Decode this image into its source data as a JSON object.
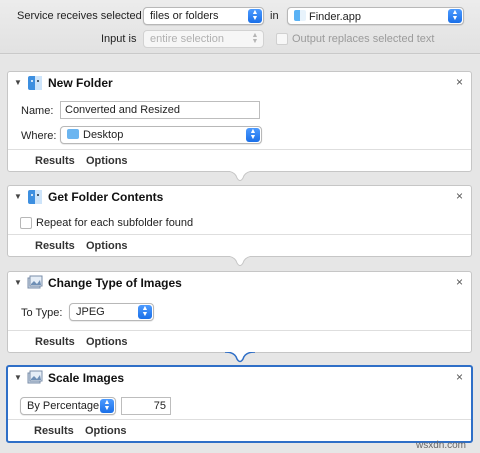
{
  "service": {
    "receives_label": "Service receives selected",
    "receives_value": "files or folders",
    "in_label": "in",
    "app_value": "Finder.app",
    "input_label": "Input is",
    "input_value": "entire selection",
    "replace_label": "Output replaces selected text"
  },
  "actions": [
    {
      "title": "New Folder",
      "name_label": "Name:",
      "name_value": "Converted and Resized",
      "where_label": "Where:",
      "where_value": "Desktop",
      "results": "Results",
      "options": "Options"
    },
    {
      "title": "Get Folder Contents",
      "repeat_label": "Repeat for each subfolder found",
      "results": "Results",
      "options": "Options"
    },
    {
      "title": "Change Type of Images",
      "type_label": "To Type:",
      "type_value": "JPEG",
      "results": "Results",
      "options": "Options"
    },
    {
      "title": "Scale Images",
      "scale_mode": "By Percentage",
      "scale_value": "75",
      "results": "Results",
      "options": "Options"
    }
  ],
  "close_glyph": "×",
  "watermark": "wsxdn.com",
  "colors": {
    "selection": "#2f6fc7",
    "popup_arrows": "#1a6fe8"
  }
}
